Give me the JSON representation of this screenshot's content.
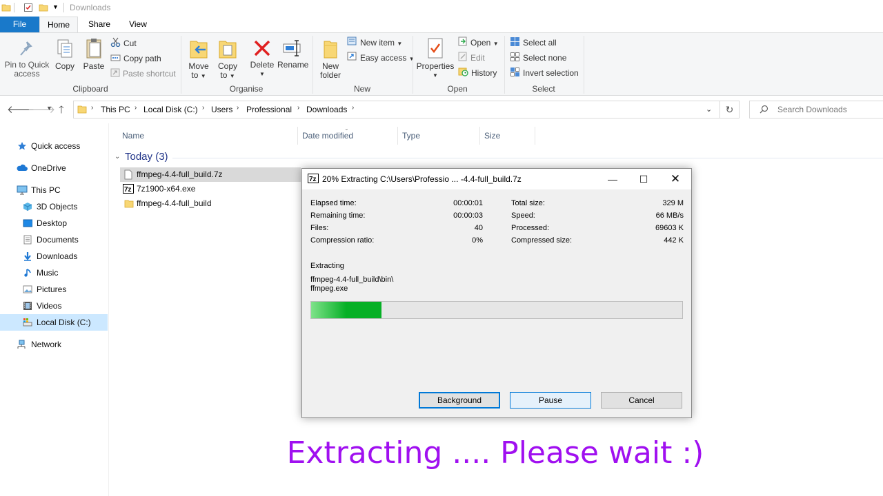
{
  "window": {
    "title": "Downloads"
  },
  "ribbon_tabs": {
    "file": "File",
    "home": "Home",
    "share": "Share",
    "view": "View"
  },
  "clipboard": {
    "pin": "Pin to Quick access",
    "pin_l1": "Pin to Quick",
    "pin_l2": "access",
    "copy": "Copy",
    "paste": "Paste",
    "cut": "Cut",
    "copy_path": "Copy path",
    "paste_shortcut": "Paste shortcut",
    "label": "Clipboard"
  },
  "organise": {
    "move_l1": "Move",
    "move_l2": "to",
    "copy_l1": "Copy",
    "copy_l2": "to",
    "delete": "Delete",
    "rename": "Rename",
    "label": "Organise"
  },
  "new": {
    "folder_l1": "New",
    "folder_l2": "folder",
    "new_item": "New item",
    "easy_access": "Easy access",
    "label": "New"
  },
  "open": {
    "properties": "Properties",
    "open": "Open",
    "edit": "Edit",
    "history": "History",
    "label": "Open"
  },
  "select": {
    "select_all": "Select all",
    "select_none": "Select none",
    "invert": "Invert selection",
    "label": "Select"
  },
  "address": {
    "crumbs": [
      "This PC",
      "Local Disk (C:)",
      "Users",
      "Professional",
      "Downloads"
    ]
  },
  "search": {
    "placeholder": "Search Downloads"
  },
  "sidebar": {
    "items": [
      "Quick access",
      "OneDrive",
      "This PC",
      "3D Objects",
      "Desktop",
      "Documents",
      "Downloads",
      "Music",
      "Pictures",
      "Videos",
      "Local Disk (C:)",
      "Network"
    ]
  },
  "columns": {
    "name": "Name",
    "date": "Date modified",
    "type": "Type",
    "size": "Size"
  },
  "group": {
    "label": "Today (3)"
  },
  "files": [
    "ffmpeg-4.4-full_build.7z",
    "7z1900-x64.exe",
    "ffmpeg-4.4-full_build"
  ],
  "dialog": {
    "title": "20% Extracting C:\\Users\\Professio ... -4.4-full_build.7z",
    "stats_left": [
      {
        "label": "Elapsed time:",
        "value": "00:00:01"
      },
      {
        "label": "Remaining time:",
        "value": "00:00:03"
      },
      {
        "label": "Files:",
        "value": "40"
      },
      {
        "label": "Compression ratio:",
        "value": "0%"
      }
    ],
    "stats_right": [
      {
        "label": "Total size:",
        "value": "329 M"
      },
      {
        "label": "Speed:",
        "value": "66 MB/s"
      },
      {
        "label": "Processed:",
        "value": "69603 K"
      },
      {
        "label": "Compressed size:",
        "value": "442 K"
      }
    ],
    "status": "Extracting",
    "path_line1": "ffmpeg-4.4-full_build\\bin\\",
    "path_line2": "ffmpeg.exe",
    "progress": 0.19,
    "buttons": {
      "background": "Background",
      "pause": "Pause",
      "cancel": "Cancel"
    }
  },
  "caption": "Extracting .... Please wait :)",
  "colors": {
    "accent": "#1979ca",
    "progress": "#06b025",
    "caption": "#a010f0",
    "selection": "#cce8ff"
  }
}
